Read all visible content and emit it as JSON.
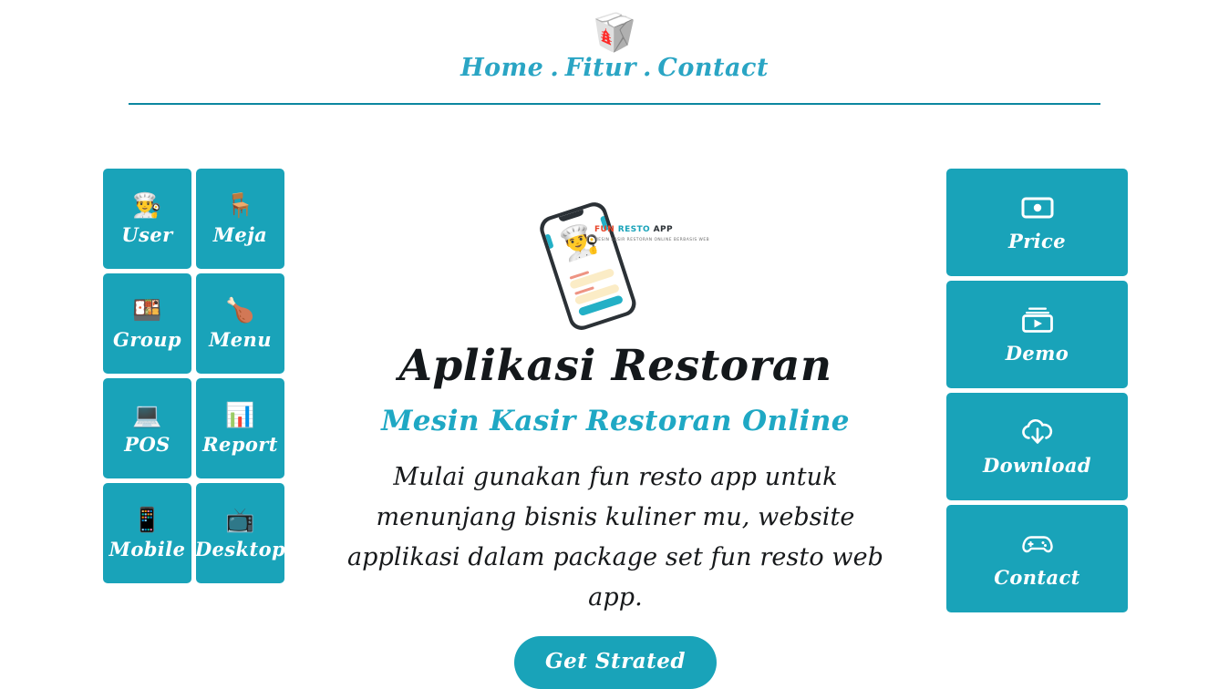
{
  "theme": {
    "tile_color": "#19a3b9",
    "accent_color": "#1fa8c4",
    "nav_color": "#2aa5c4",
    "rule_color": "#0b87a0",
    "heading_color": "#14181b",
    "page_background": "#ffffff"
  },
  "header": {
    "logo_icon": "takeout-box-icon",
    "logo_glyph": "🥡",
    "nav": [
      {
        "label": "Home",
        "icon": ""
      },
      {
        "label": "Fitur",
        "icon": ""
      },
      {
        "label": "Contact",
        "icon": ""
      }
    ],
    "nav_separator": "."
  },
  "left_tiles": [
    {
      "label": "User",
      "icon": "chef-icon",
      "glyph": "👨‍🍳"
    },
    {
      "label": "Meja",
      "icon": "chair-icon",
      "glyph": "🪑"
    },
    {
      "label": "Group",
      "icon": "bento-box-icon",
      "glyph": "🍱"
    },
    {
      "label": "Menu",
      "icon": "poultry-leg-icon",
      "glyph": "🍗"
    },
    {
      "label": "POS",
      "icon": "laptop-icon",
      "glyph": "💻"
    },
    {
      "label": "Report",
      "icon": "bar-chart-icon",
      "glyph": "📊"
    },
    {
      "label": "Mobile",
      "icon": "mobile-phone-icon",
      "glyph": "📱"
    },
    {
      "label": "Desktop",
      "icon": "television-icon",
      "glyph": "📺"
    }
  ],
  "right_tiles": [
    {
      "label": "Price",
      "icon": "banknote-icon"
    },
    {
      "label": "Demo",
      "icon": "video-play-icon"
    },
    {
      "label": "Download",
      "icon": "cloud-download-icon"
    },
    {
      "label": "Contact",
      "icon": "game-controller-icon"
    }
  ],
  "hero": {
    "phone_mockup": {
      "icon": "smartphone-mockup",
      "screen_chef_glyph": "👨‍🍳",
      "caption_part1": "FUN ",
      "caption_part2": "RESTO ",
      "caption_part3": "APP",
      "caption_subtitle": "MESIN KASIR RESTORAN ONLINE BERBASIS WEB"
    },
    "title": "Aplikasi Restoran",
    "subtitle": "Mesin Kasir Restoran Online",
    "description": "Mulai gunakan fun resto app untuk menunjang bisnis kuliner mu, website applikasi dalam package set fun resto web app.",
    "cta_label": "Get Strated"
  }
}
